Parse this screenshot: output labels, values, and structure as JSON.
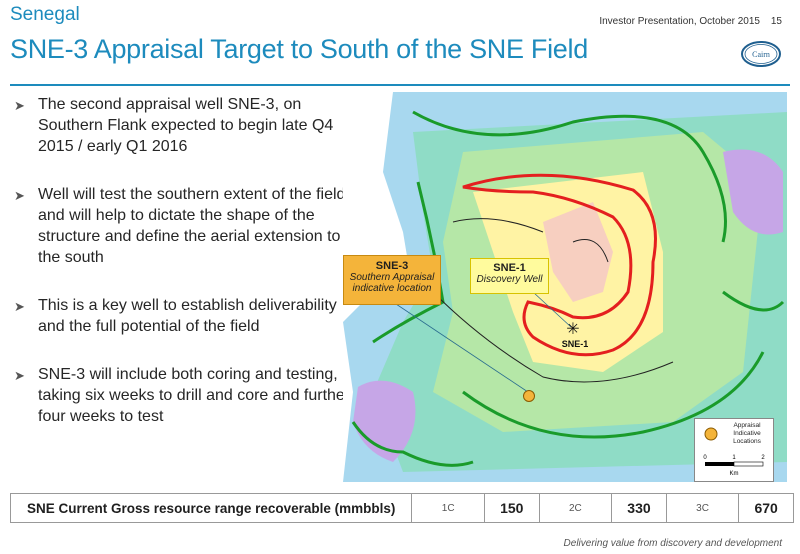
{
  "header": {
    "region": "Senegal",
    "title": "SNE-3 Appraisal Target to South of the SNE Field",
    "meta": "Investor Presentation, October 2015",
    "page_number": "15",
    "logo_text": "Cairn"
  },
  "bullets": [
    "The second appraisal well SNE-3, on Southern Flank expected to begin late Q4 2015 / early Q1 2016",
    "Well will test the southern extent of the field and will help to dictate the shape of the structure and define the aerial extension to the south",
    "This is a key well to establish deliverability and the full potential of the field",
    "SNE-3 will include both coring and testing, taking six weeks to drill and core and further four weeks to test"
  ],
  "map": {
    "callout_sne3": {
      "title": "SNE-3",
      "subtitle": "Southern Appraisal indicative location"
    },
    "callout_sne1": {
      "title": "SNE-1",
      "subtitle": "Discovery Well"
    },
    "well_label": "SNE-1",
    "legend": {
      "title": "Appraisal Indicative Locations",
      "scale": [
        "0",
        "1",
        "2"
      ],
      "unit": "Km"
    }
  },
  "resource_table": {
    "label": "SNE Current Gross resource range recoverable (mmbbls)",
    "cells": [
      {
        "class": "1C",
        "value": "150"
      },
      {
        "class": "2C",
        "value": "330"
      },
      {
        "class": "3C",
        "value": "670"
      }
    ]
  },
  "footer": "Delivering value from discovery and development",
  "colors": {
    "accent": "#1d8bbd",
    "callout_sne3": "#f4b43a",
    "callout_sne1": "#fffb9d"
  }
}
